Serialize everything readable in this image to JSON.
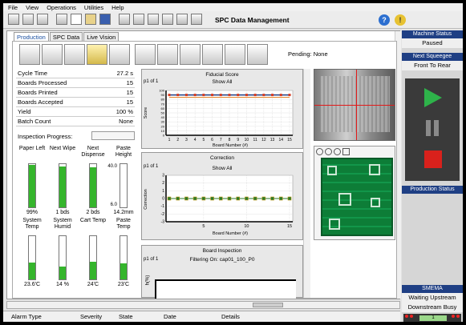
{
  "menu": [
    "File",
    "View",
    "Operations",
    "Utilities",
    "Help"
  ],
  "app_title": "SPC Data Management",
  "tabs": [
    "Production",
    "SPC Data",
    "Live Vision"
  ],
  "pending": "Pending: None",
  "stats": [
    {
      "label": "Cycle Time",
      "value": "27.2 s"
    },
    {
      "label": "Boards Processed",
      "value": "15"
    },
    {
      "label": "Boards Printed",
      "value": "15"
    },
    {
      "label": "Boards Accepted",
      "value": "15"
    },
    {
      "label": "Yield",
      "value": "100 %"
    },
    {
      "label": "Batch Count",
      "value": "None"
    }
  ],
  "inspection_progress": "Inspection Progress:",
  "gauges_top": [
    {
      "label": "Paper Left",
      "value": "99%",
      "fill": 0.99
    },
    {
      "label": "Next Wipe",
      "value": "1 bds",
      "fill": 0.95
    },
    {
      "label": "Next Dispense",
      "value": "2 bds",
      "fill": 0.92
    },
    {
      "label": "Paste Height",
      "value": "14.2mm",
      "fill": 0.0,
      "max": "40.0",
      "min": "6.0"
    }
  ],
  "gauges_bottom": [
    {
      "label": "System Temp",
      "value": "23.6'C",
      "fill": 0.38
    },
    {
      "label": "System Humid",
      "value": "14 %",
      "fill": 0.3
    },
    {
      "label": "Cart Temp",
      "value": "24'C",
      "fill": 0.4
    },
    {
      "label": "Paste Temp",
      "value": "23'C",
      "fill": 0.37
    }
  ],
  "chart_data": [
    {
      "type": "line",
      "title": "Fiducial Score",
      "subtitle": "Show All",
      "page": "p1 of 1",
      "xlabel": "Board Number (#)",
      "ylabel": "Score",
      "x": [
        1,
        2,
        3,
        4,
        5,
        6,
        7,
        8,
        9,
        10,
        11,
        12,
        13,
        14,
        15
      ],
      "ylim": [
        0,
        100
      ],
      "yticks": [
        "0",
        "10",
        "20",
        "30",
        "40",
        "50",
        "60",
        "70",
        "80",
        "90",
        "100"
      ],
      "series": [
        {
          "values": [
            90,
            90,
            90,
            90,
            90,
            90,
            90,
            90,
            90,
            90,
            90,
            90,
            90,
            90,
            90
          ]
        }
      ]
    },
    {
      "type": "line",
      "title": "Correction",
      "subtitle": "Show All",
      "page": "p1 of 1",
      "xlabel": "Board Number (#)",
      "ylabel": "Correction",
      "ylim": [
        -3,
        3
      ],
      "yticks": [
        "-3",
        "-2",
        "-1",
        "0",
        "1",
        "2",
        "3"
      ],
      "xticks": [
        "5",
        "10",
        "15"
      ],
      "x": [
        1,
        2,
        3,
        4,
        5,
        6,
        7,
        8,
        9,
        10,
        11,
        12,
        13,
        14,
        15
      ],
      "series": [
        {
          "values": [
            0,
            0,
            0,
            0,
            0,
            0,
            0,
            0,
            0,
            0,
            0,
            0,
            0,
            0,
            0
          ]
        }
      ]
    },
    {
      "type": "line",
      "title": "Board Inspection",
      "subtitle": "Filtering On: cap01_100_P0",
      "page": "p1 of 1",
      "ylabel": "h(%)"
    }
  ],
  "side": {
    "machine_status_title": "Machine Status",
    "machine_status": "Paused",
    "next_squeegee_title": "Next Squeegee",
    "next_squeegee": "Front To Rear",
    "production_status_title": "Production Status",
    "smema_title": "SMEMA",
    "smema_up": "Waiting Upstream",
    "smema_down": "Downstream Busy",
    "counter": "1"
  },
  "alarm_columns": [
    "Alarm Type",
    "Severity",
    "State",
    "Date",
    "Details"
  ],
  "colors": {
    "header": "#1f3f84",
    "play": "#2eb34a",
    "stop": "#d9211c",
    "gauge": "#35b52c"
  }
}
